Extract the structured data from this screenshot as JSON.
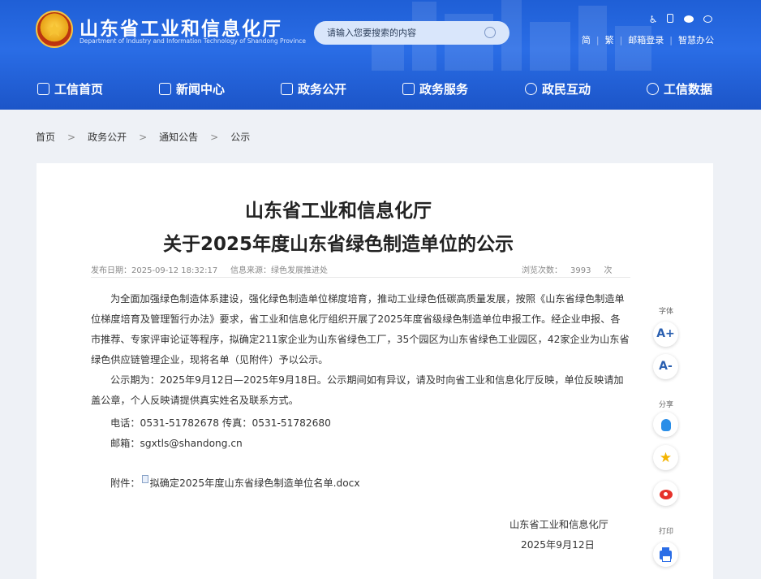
{
  "header": {
    "site_title": "山东省工业和信息化厅",
    "site_subtitle": "Department of Industry and Information Technology of Shandong Province",
    "search_placeholder": "请输入您要搜索的内容",
    "tool_icons": [
      "accessibility-icon",
      "mobile-icon",
      "wechat-icon",
      "weibo-icon"
    ],
    "toplinks": [
      "简",
      "繁",
      "邮箱登录",
      "智慧办公"
    ]
  },
  "nav": [
    {
      "label": "工信首页",
      "icon": "home-icon"
    },
    {
      "label": "新闻中心",
      "icon": "news-icon"
    },
    {
      "label": "政务公开",
      "icon": "monitor-icon"
    },
    {
      "label": "政务服务",
      "icon": "service-icon"
    },
    {
      "label": "政民互动",
      "icon": "chat-icon"
    },
    {
      "label": "工信数据",
      "icon": "database-icon"
    }
  ],
  "breadcrumb": [
    "首页",
    "政务公开",
    "通知公告",
    "公示"
  ],
  "breadcrumb_sep": ">",
  "article": {
    "title_line1": "山东省工业和信息化厅",
    "title_line2": "关于2025年度山东省绿色制造单位的公示",
    "date": "发布日期：2025-09-12 18:32:17",
    "source": "信息来源：绿色发展推进处",
    "views_label": "浏览次数：",
    "views_count": "3993",
    "views_unit": "次",
    "para1": "为全面加强绿色制造体系建设，强化绿色制造单位梯度培育，推动工业绿色低碳高质量发展，按照《山东省绿色制造单位梯度培育及管理暂行办法》要求，省工业和信息化厅组织开展了2025年度省级绿色制造单位申报工作。经企业申报、各市推荐、专家评审论证等程序，拟确定211家企业为山东省绿色工厂，35个园区为山东省绿色工业园区，42家企业为山东省绿色供应链管理企业，现将名单（见附件）予以公示。",
    "para2": "公示期为：2025年9月12日—2025年9月18日。公示期间如有异议，请及时向省工业和信息化厅反映，单位反映请加盖公章，个人反映请提供真实姓名及联系方式。",
    "contact_phone": "电话：0531-51782678   传真：0531-51782680",
    "contact_email": "邮箱：sgxtls@shandong.cn",
    "attachment_label": "附件：",
    "attachment_name": "拟确定2025年度山东省绿色制造单位名单.docx",
    "signer": "山东省工业和信息化厅",
    "sign_date": "2025年9月12日"
  },
  "sidebar": {
    "font_label": "字体",
    "font_up": "A+",
    "font_down": "A-",
    "share_label": "分享",
    "print_label": "打印"
  },
  "colors": {
    "header_blue": "#2a6de6",
    "page_bg": "#eef1f6"
  }
}
